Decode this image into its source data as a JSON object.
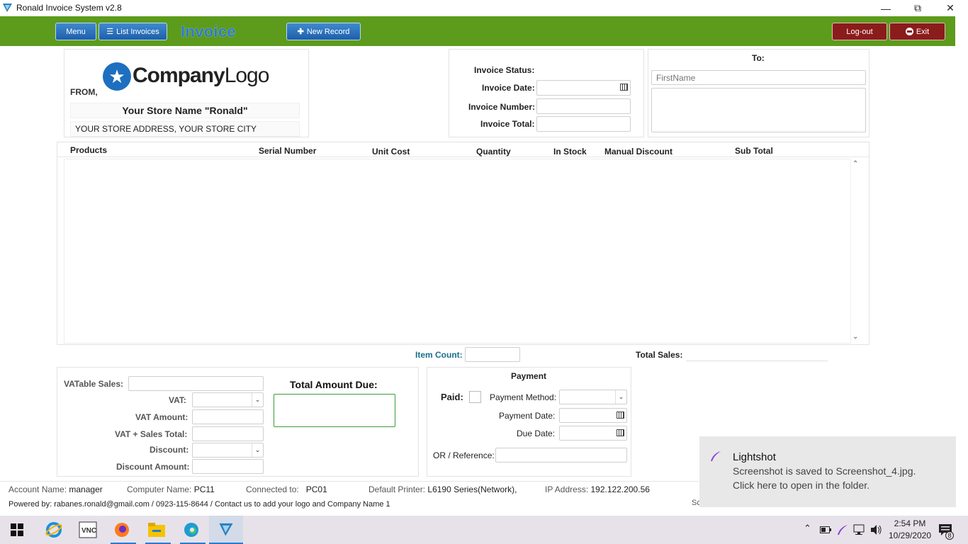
{
  "window": {
    "title": "Ronald Invoice System v2.8"
  },
  "toolbar": {
    "menu": "Menu",
    "list_invoices": "List Invoices",
    "heading": "Invoice",
    "new_record": "New Record",
    "logout": "Log-out",
    "exit": "Exit"
  },
  "from": {
    "label": "FROM,",
    "logo_company": "Company",
    "logo_suffix": "Logo",
    "store_name": "Your Store Name \"Ronald\"",
    "store_address": "YOUR STORE ADDRESS, YOUR STORE CITY"
  },
  "invoice_info": {
    "status_label": "Invoice Status:",
    "date_label": "Invoice Date:",
    "number_label": "Invoice Number:",
    "total_label": "Invoice Total:"
  },
  "to": {
    "label": "To:",
    "firstname_placeholder": "FirstName"
  },
  "table": {
    "columns": [
      "Products",
      "Serial Number",
      "Unit Cost",
      "Quantity",
      "In Stock",
      "Manual Discount",
      "Sub Total"
    ]
  },
  "summary": {
    "item_count_label": "Item Count:",
    "total_sales_label": "Total Sales:"
  },
  "vat": {
    "vatable_sales": "VATable Sales:",
    "vat": "VAT:",
    "vat_amount": "VAT Amount:",
    "vat_sales_total": "VAT + Sales Total:",
    "discount": "Discount:",
    "discount_amount": "Discount Amount:",
    "total_amount_due": "Total Amount Due:"
  },
  "payment": {
    "title": "Payment",
    "paid": "Paid:",
    "method": "Payment Method:",
    "date": "Payment Date:",
    "due_date": "Due Date:",
    "reference": "OR / Reference:"
  },
  "status": {
    "account_label": "Account Name:",
    "account_value": "manager",
    "computer_label": "Computer Name:",
    "computer_value": "PC11",
    "connected_label": "Connected to:",
    "connected_value": "PC01",
    "printer_label": "Default Printer:",
    "printer_value": "L6190 Series(Network),",
    "ip_label": "IP Address:",
    "ip_value": "192.122.200.56",
    "powered_by": "Powered by: rabanes.ronald@gmail.com / 0923-115-8644  /  Contact us to add your logo and Company Name 1",
    "cut_text": "Sc"
  },
  "toast": {
    "app": "Lightshot",
    "line1": "Screenshot is saved to Screenshot_4.jpg.",
    "line2": "Click here to open in the folder."
  },
  "taskbar": {
    "time": "2:54 PM",
    "date": "10/29/2020",
    "notif_count": "8"
  },
  "colors": {
    "toolbar_green": "#5c9b1b",
    "button_blue": "#2f74c0",
    "button_red": "#8b1c1c",
    "heading_blue": "#2a7bd1",
    "link_teal": "#1a6f8a"
  }
}
